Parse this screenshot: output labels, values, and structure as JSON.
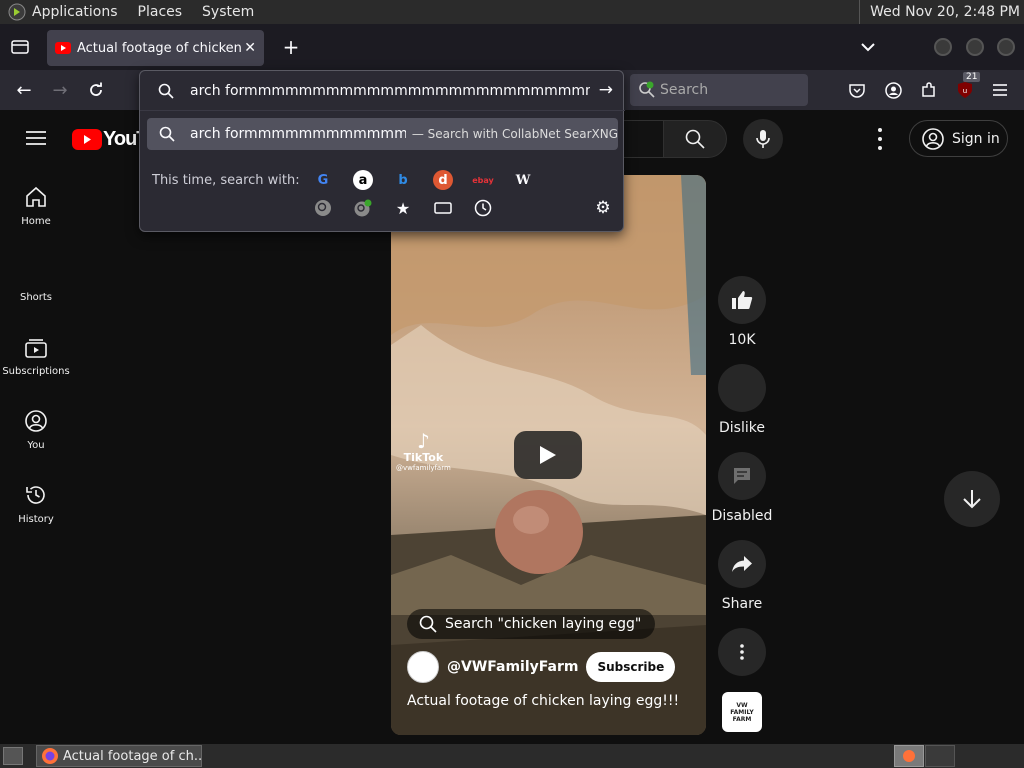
{
  "panel": {
    "menus": [
      "Applications",
      "Places",
      "System"
    ],
    "clock": "Wed Nov 20,  2:48 PM"
  },
  "browser": {
    "tab_title": "Actual footage of chicken la",
    "search_placeholder": "Search",
    "extension_badge": "21",
    "urlbar": {
      "value": "arch formmmmmmmmmmmmmmmmmmmmmmmmmmmmmumshttp",
      "suggestion_text": "arch formmmmmmmmmmmmmmmmm",
      "suggestion_engine": "— Search with CollabNet SearXNG",
      "one_time_label": "This time, search with:",
      "engines": [
        "Google",
        "Amazon",
        "Bing",
        "DuckDuckGo",
        "eBay",
        "Wikipedia"
      ]
    }
  },
  "youtube": {
    "logo_text": "YouTube",
    "sign_in": "Sign in",
    "sidebar": [
      "Home",
      "Shorts",
      "Subscriptions",
      "You",
      "History"
    ],
    "video": {
      "watermark": "TikTok",
      "watermark_handle": "@vwfamilyfarm",
      "search_chip": "Search \"chicken laying egg\"",
      "channel": "@VWFamilyFarm",
      "subscribe": "Subscribe",
      "title": "Actual footage of chicken laying egg!!!"
    },
    "actions": {
      "likes": "10K",
      "dislike": "Dislike",
      "comments": "Disabled",
      "share": "Share"
    },
    "channel_avatar_text": "VW FAMILY FARM"
  },
  "taskbar": {
    "window_title": "Actual footage of ch..."
  }
}
